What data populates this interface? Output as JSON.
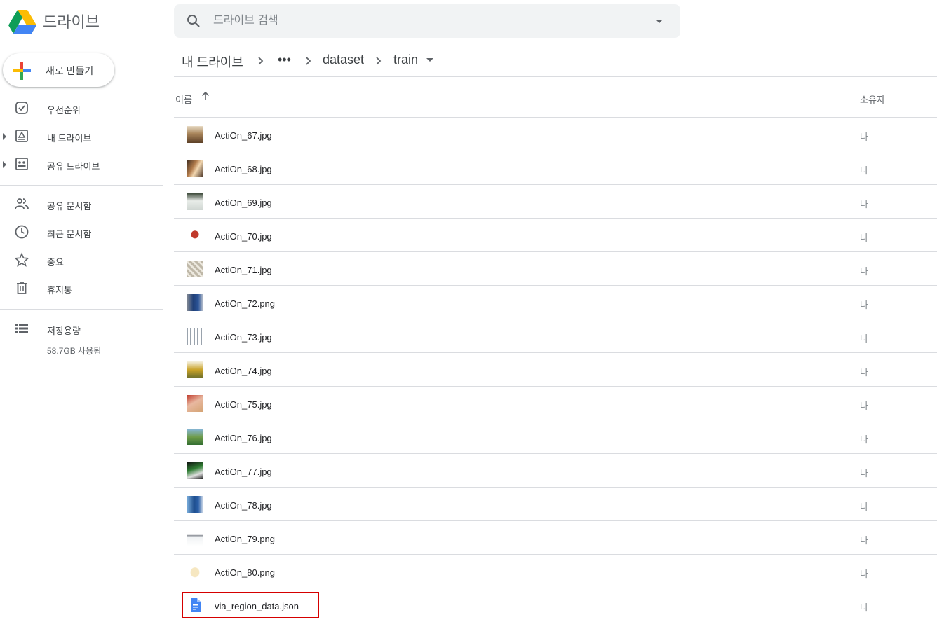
{
  "header": {
    "brand": "드라이브",
    "search_placeholder": "드라이브 검색"
  },
  "sidebar": {
    "new_label": "새로 만들기",
    "items": [
      {
        "label": "우선순위",
        "icon": "priority-icon"
      },
      {
        "label": "내 드라이브",
        "icon": "my-drive-icon"
      },
      {
        "label": "공유 드라이브",
        "icon": "shared-drives-icon"
      },
      {
        "label": "공유 문서함",
        "icon": "shared-with-me-icon"
      },
      {
        "label": "최근 문서함",
        "icon": "recent-icon"
      },
      {
        "label": "중요",
        "icon": "starred-icon"
      },
      {
        "label": "휴지통",
        "icon": "trash-icon"
      },
      {
        "label": "저장용량",
        "icon": "storage-icon"
      }
    ],
    "storage_used": "58.7GB 사용됨"
  },
  "breadcrumb": {
    "items": [
      "내 드라이브",
      "•••",
      "dataset",
      "train"
    ]
  },
  "columns": {
    "name": "이름",
    "owner": "소유자"
  },
  "files": [
    {
      "name": "ActiOn_67.jpg",
      "owner": "나"
    },
    {
      "name": "ActiOn_68.jpg",
      "owner": "나"
    },
    {
      "name": "ActiOn_69.jpg",
      "owner": "나"
    },
    {
      "name": "ActiOn_70.jpg",
      "owner": "나"
    },
    {
      "name": "ActiOn_71.jpg",
      "owner": "나"
    },
    {
      "name": "ActiOn_72.png",
      "owner": "나"
    },
    {
      "name": "ActiOn_73.jpg",
      "owner": "나"
    },
    {
      "name": "ActiOn_74.jpg",
      "owner": "나"
    },
    {
      "name": "ActiOn_75.jpg",
      "owner": "나"
    },
    {
      "name": "ActiOn_76.jpg",
      "owner": "나"
    },
    {
      "name": "ActiOn_77.jpg",
      "owner": "나"
    },
    {
      "name": "ActiOn_78.jpg",
      "owner": "나"
    },
    {
      "name": "ActiOn_79.png",
      "owner": "나"
    },
    {
      "name": "ActiOn_80.png",
      "owner": "나"
    },
    {
      "name": "via_region_data.json",
      "owner": "나"
    }
  ],
  "colors": {
    "highlight": "#d50000",
    "doc_blue": "#4285f4"
  }
}
